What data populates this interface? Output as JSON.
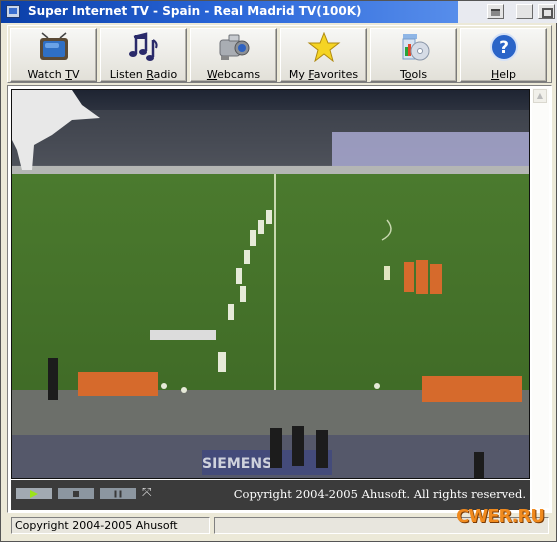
{
  "window": {
    "title": "Super Internet TV - Spain - Real Madrid TV(100K)",
    "icon": "tv-app-icon",
    "controls": [
      "minimize",
      "maximize",
      "close"
    ]
  },
  "toolbar": {
    "buttons": [
      {
        "id": "watch-tv",
        "label_pre": "Watch ",
        "label_key": "T",
        "label_post": "V",
        "icon": "television-icon"
      },
      {
        "id": "listen-radio",
        "label_pre": "Listen ",
        "label_key": "R",
        "label_post": "adio",
        "icon": "music-notes-icon"
      },
      {
        "id": "webcams",
        "label_pre": "",
        "label_key": "W",
        "label_post": "ebcams",
        "icon": "camcorder-icon"
      },
      {
        "id": "my-favorites",
        "label_pre": "My ",
        "label_key": "F",
        "label_post": "avorites",
        "icon": "star-icon"
      },
      {
        "id": "tools",
        "label_pre": "T",
        "label_key": "o",
        "label_post": "ols",
        "icon": "tools-cd-icon"
      },
      {
        "id": "help",
        "label_pre": "",
        "label_key": "H",
        "label_post": "elp",
        "icon": "help-question-icon"
      }
    ]
  },
  "video": {
    "content": "Live football broadcast from stadium",
    "board_text": "SIEMENS"
  },
  "player": {
    "play": "play",
    "stop": "stop",
    "pause": "pause",
    "fullscreen": "fullscreen",
    "copyright": "Copyright 2004-2005 Ahusoft. All rights reserved."
  },
  "status": {
    "left": "Copyright 2004-2005 Ahusoft",
    "right": ""
  },
  "watermark": "CWER.RU"
}
